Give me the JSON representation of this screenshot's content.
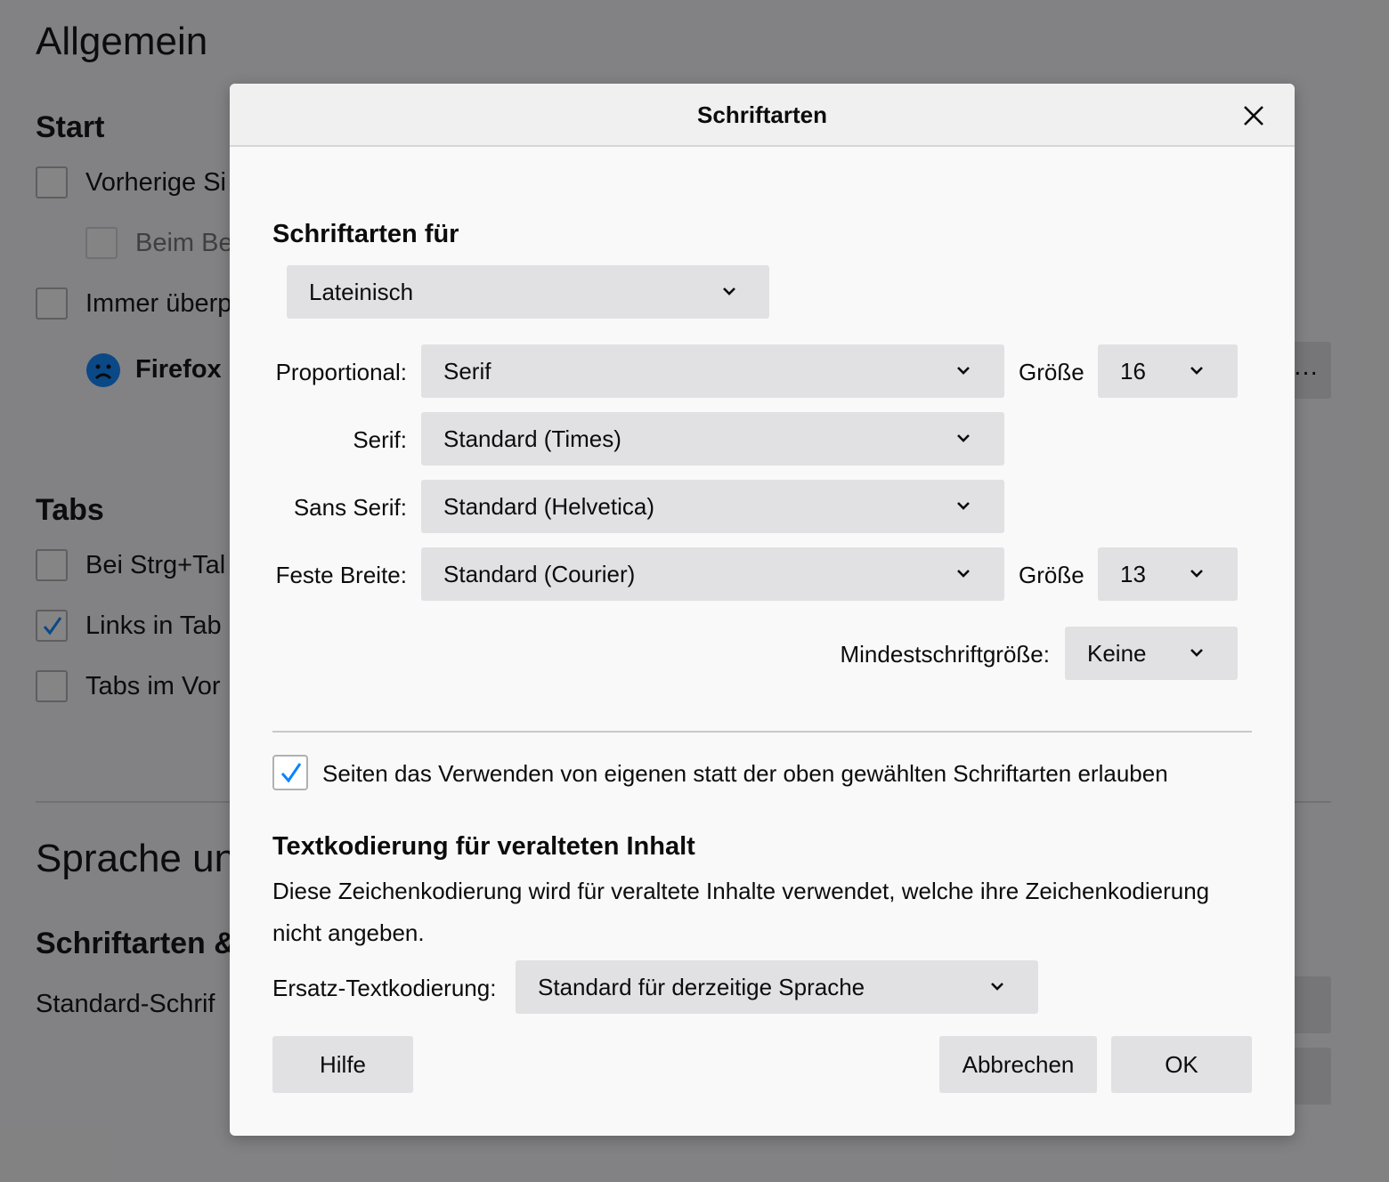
{
  "background": {
    "page_title": "Allgemein",
    "start_heading": "Start",
    "start_items": [
      "Vorherige Si",
      "Beim Be",
      "Immer überp"
    ],
    "firefox_label": "Firefox",
    "side_button_text": "…",
    "tabs_heading": "Tabs",
    "tabs_items": [
      {
        "label": "Bei Strg+Tal",
        "checked": false
      },
      {
        "label": "Links in Tab",
        "checked": true
      },
      {
        "label": "Tabs im Vor",
        "checked": false
      }
    ],
    "language_heading": "Sprache un",
    "fonts_heading": "Schriftarten &",
    "default_font_label": "Standard-Schrif"
  },
  "dialog": {
    "title": "Schriftarten",
    "fonts_for_heading": "Schriftarten für",
    "language_select": "Lateinisch",
    "proportional_label": "Proportional:",
    "proportional_value": "Serif",
    "size_label": "Größe",
    "proportional_size": "16",
    "serif_label": "Serif:",
    "serif_value": "Standard (Times)",
    "sans_serif_label": "Sans Serif:",
    "sans_serif_value": "Standard (Helvetica)",
    "monospace_label": "Feste Breite:",
    "monospace_value": "Standard (Courier)",
    "monospace_size": "13",
    "min_size_label": "Mindestschriftgröße:",
    "min_size_value": "Keine",
    "allow_own_fonts_label": "Seiten das Verwenden von eigenen statt der oben gewählten Schriftarten erlauben",
    "allow_own_fonts_checked": true,
    "encoding_heading": "Textkodierung für veralteten Inhalt",
    "encoding_description": "Diese Zeichenkodierung wird für veraltete Inhalte verwendet, welche ihre Zeichenkodierung nicht angeben.",
    "fallback_encoding_label": "Ersatz-Textkodierung:",
    "fallback_encoding_value": "Standard für derzeitige Sprache",
    "help_button": "Hilfe",
    "cancel_button": "Abbrechen",
    "ok_button": "OK"
  },
  "colors": {
    "checkmark": "#0a84ff",
    "firefox_icon": "#0a84ff"
  }
}
